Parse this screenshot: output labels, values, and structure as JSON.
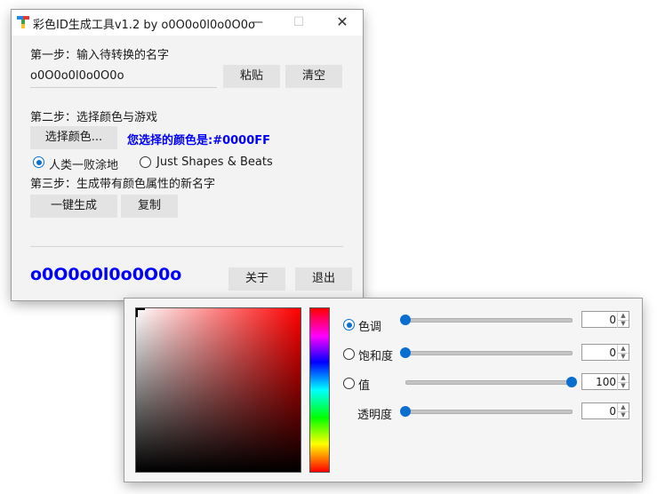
{
  "main_window": {
    "title": "彩色ID生成工具v1.2  by o0O0o0l0o0O0o",
    "min_glyph": "—",
    "max_glyph": "☐",
    "close_glyph": "✕",
    "step1_label": "第一步：输入待转换的名字",
    "name_input_value": "o0O0o0l0o0O0o",
    "paste_button": "粘贴",
    "clear_button": "清空",
    "step2_label": "第二步：选择颜色与游戏",
    "choose_color_button": "选择颜色...",
    "selected_color_text": "您选择的颜色是:#0000FF",
    "selected_color": "#0000FF",
    "game_options": [
      "人类一败涂地",
      "Just Shapes & Beats"
    ],
    "selected_game": "人类一败涂地",
    "step3_label": "第三步：生成带有颜色属性的新名字",
    "generate_button": "一键生成",
    "copy_button": "复制",
    "result_text": "o0O0o0l0o0O0o",
    "about_button": "关于",
    "exit_button": "退出"
  },
  "color_picker": {
    "rows": [
      {
        "label": "色调",
        "value": "0",
        "radio": true,
        "selected": true
      },
      {
        "label": "饱和度",
        "value": "0",
        "radio": true,
        "selected": false
      },
      {
        "label": "值",
        "value": "100",
        "radio": true,
        "selected": false
      },
      {
        "label": "透明度",
        "value": "0",
        "radio": false,
        "selected": false
      }
    ],
    "spin_up_glyph": "▲",
    "spin_down_glyph": "▼",
    "accent_color": "#0a6ed1"
  }
}
